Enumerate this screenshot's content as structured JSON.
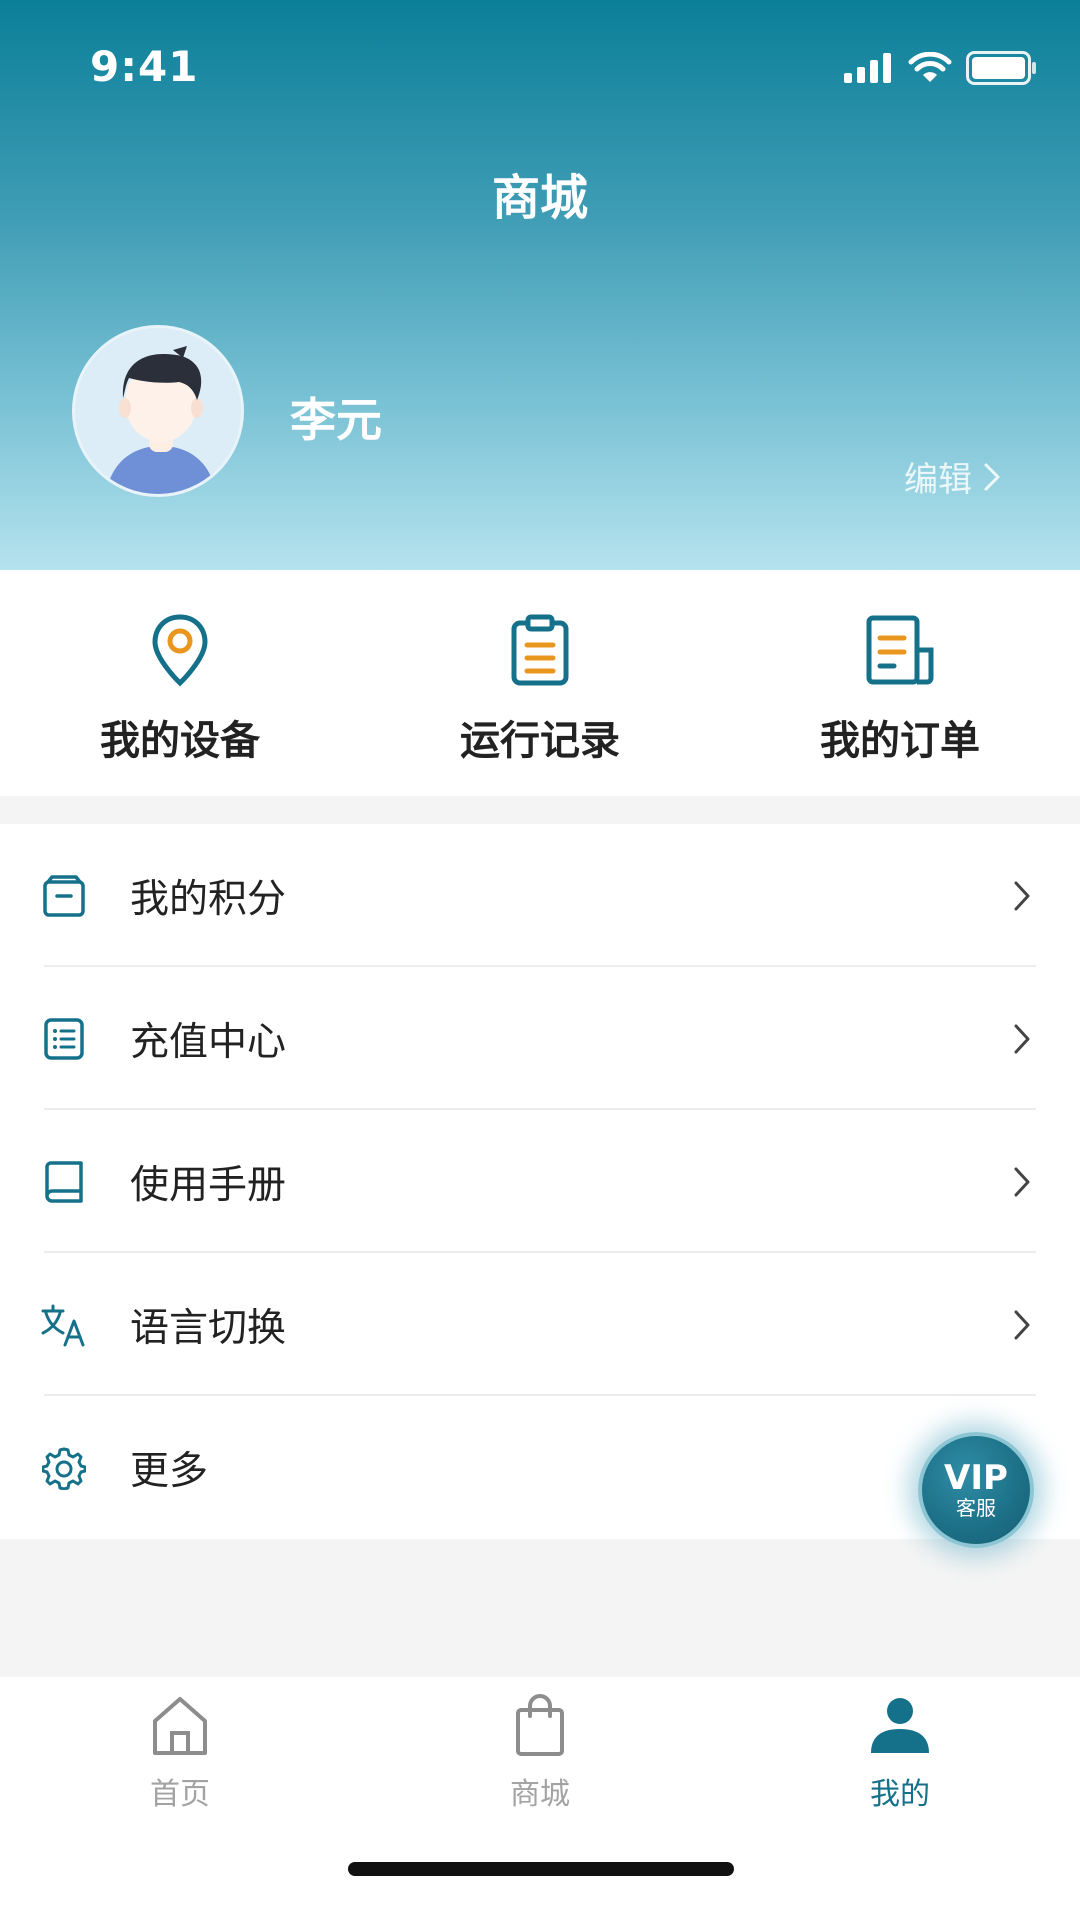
{
  "status_bar": {
    "time": "9:41"
  },
  "header": {
    "title": "商城",
    "user_name": "李元",
    "edit_label": "编辑"
  },
  "quick_actions": [
    {
      "label": "我的设备",
      "icon": "location-pin-icon"
    },
    {
      "label": "运行记录",
      "icon": "clipboard-icon"
    },
    {
      "label": "我的订单",
      "icon": "document-icon"
    }
  ],
  "menu": [
    {
      "label": "我的积分",
      "icon": "archive-box-icon"
    },
    {
      "label": "充值中心",
      "icon": "list-icon"
    },
    {
      "label": "使用手册",
      "icon": "book-icon"
    },
    {
      "label": "语言切换",
      "icon": "translate-icon"
    },
    {
      "label": "更多",
      "icon": "gear-icon"
    }
  ],
  "vip": {
    "title": "VIP",
    "subtitle": "客服"
  },
  "tabs": [
    {
      "label": "首页",
      "icon": "home-icon",
      "active": false
    },
    {
      "label": "商城",
      "icon": "shopping-bag-icon",
      "active": false
    },
    {
      "label": "我的",
      "icon": "user-icon",
      "active": true
    }
  ],
  "colors": {
    "accent": "#15718a",
    "icon_highlight": "#e8961e",
    "header_top": "#0b7f98",
    "header_bottom": "#b5e3ee",
    "inactive_tab": "#a3a3a3"
  }
}
